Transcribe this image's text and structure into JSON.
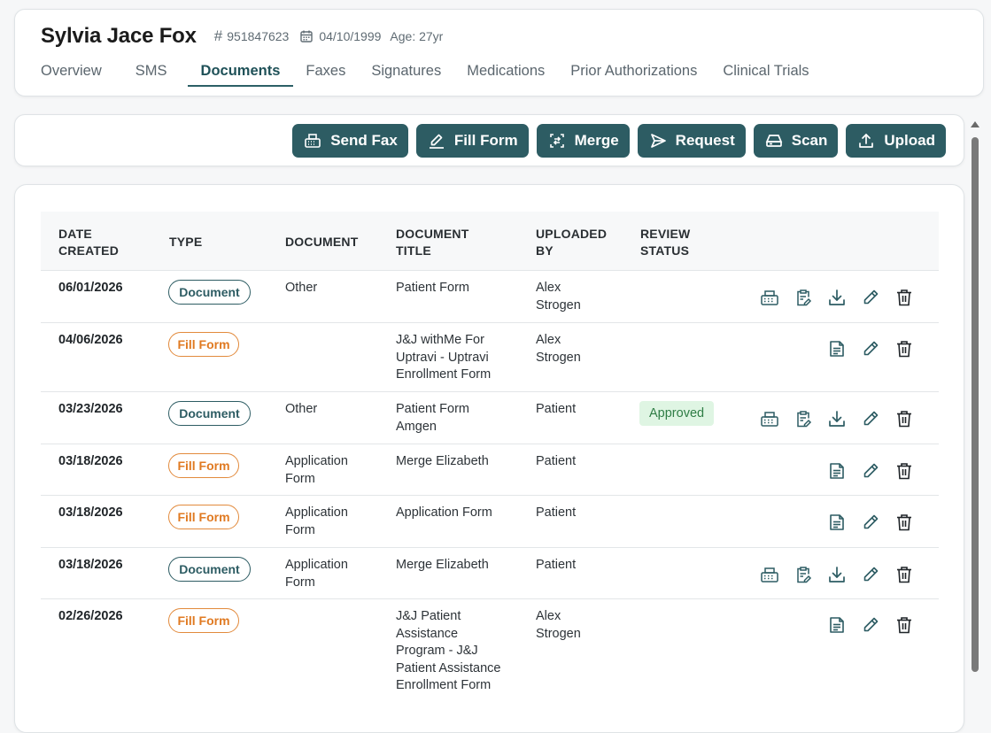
{
  "patient": {
    "name": "Sylvia Jace Fox",
    "id": "951847623",
    "dob": "04/10/1999",
    "age": "Age: 27yr"
  },
  "tabs": [
    {
      "label": "Overview",
      "active": false
    },
    {
      "label": "SMS",
      "active": false
    },
    {
      "label": "Documents",
      "active": true
    },
    {
      "label": "Faxes",
      "active": false
    },
    {
      "label": "Signatures",
      "active": false
    },
    {
      "label": "Medications",
      "active": false
    },
    {
      "label": "Prior Authorizations",
      "active": false
    },
    {
      "label": "Clinical Trials",
      "active": false
    }
  ],
  "toolbar": {
    "send_fax": "Send Fax",
    "fill_form": "Fill Form",
    "merge": "Merge",
    "request": "Request",
    "scan": "Scan",
    "upload": "Upload"
  },
  "table": {
    "headers": {
      "date_created": "DATE CREATED",
      "type": "TYPE",
      "document": "DOCUMENT",
      "document_title": "DOCUMENT TITLE",
      "uploaded_by": "UPLOADED BY",
      "review_status": "REVIEW STATUS"
    },
    "rows": [
      {
        "date": "06/01/2026",
        "type": "Document",
        "document": "Other",
        "title": "Patient Form",
        "uploaded_by": "Alex Strogen",
        "status": ""
      },
      {
        "date": "04/06/2026",
        "type": "Fill Form",
        "document": "",
        "title": "J&J withMe For Uptravi - Uptravi Enrollment Form",
        "uploaded_by": "Alex Strogen",
        "status": ""
      },
      {
        "date": "03/23/2026",
        "type": "Document",
        "document": "Other",
        "title": "Patient Form Amgen",
        "uploaded_by": "Patient",
        "status": "Approved"
      },
      {
        "date": "03/18/2026",
        "type": "Fill Form",
        "document": "Application Form",
        "title": "Merge Elizabeth",
        "uploaded_by": "Patient",
        "status": ""
      },
      {
        "date": "03/18/2026",
        "type": "Fill Form",
        "document": "Application Form",
        "title": "Application Form",
        "uploaded_by": "Patient",
        "status": ""
      },
      {
        "date": "03/18/2026",
        "type": "Document",
        "document": "Application Form",
        "title": "Merge Elizabeth",
        "uploaded_by": "Patient",
        "status": ""
      },
      {
        "date": "02/26/2026",
        "type": "Fill Form",
        "document": "",
        "title": "J&J Patient Assistance Program - J&J Patient Assistance Enrollment Form",
        "uploaded_by": "Alex Strogen",
        "status": ""
      }
    ]
  },
  "colors": {
    "primary": "#2d5c63",
    "fill_form": "#e07a22",
    "approved_bg": "#dff5e3",
    "approved_text": "#2f7d45"
  },
  "icons": {
    "row_document": [
      "fax-icon",
      "clipboard-edit-icon",
      "download-icon",
      "pencil-icon",
      "trash-icon"
    ],
    "row_fill_form": [
      "file-text-icon",
      "pencil-icon",
      "trash-icon"
    ]
  }
}
